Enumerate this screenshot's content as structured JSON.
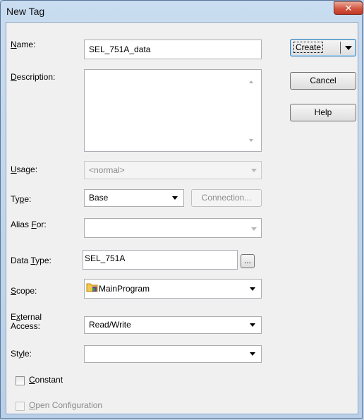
{
  "window": {
    "title": "New Tag",
    "close_glyph": "✕"
  },
  "fields": {
    "name": {
      "label_u": "N",
      "label_rest": "ame:",
      "value": "SEL_751A_data"
    },
    "description": {
      "label_u": "D",
      "label_rest": "escription:",
      "value": ""
    },
    "usage": {
      "label_u": "U",
      "label_rest": "sage:",
      "value": "<normal>"
    },
    "type": {
      "label_pre": "Ty",
      "label_u": "p",
      "label_rest": "e:",
      "value": "Base"
    },
    "connection_button": {
      "u": "C",
      "rest": "onnection..."
    },
    "alias_for": {
      "label_pre": "Alias ",
      "label_u": "F",
      "label_rest": "or:",
      "value": ""
    },
    "data_type": {
      "label_pre": "Data ",
      "label_u": "T",
      "label_rest": "ype:",
      "value": "SEL_751A",
      "browse": "..."
    },
    "scope": {
      "label_u": "S",
      "label_rest": "cope:",
      "value": "MainProgram",
      "icon": "program-folder-icon"
    },
    "external_access": {
      "line1_pre": "E",
      "line1_u": "x",
      "line1_rest": "ternal",
      "line2": "Access:",
      "value": "Read/Write"
    },
    "style": {
      "label_pre": "St",
      "label_u": "y",
      "label_rest": "le:",
      "value": ""
    }
  },
  "checkboxes": {
    "constant": {
      "u": "C",
      "rest": "onstant",
      "checked": false
    },
    "open_configuration": {
      "u": "O",
      "rest": "pen Configuration",
      "checked": false
    }
  },
  "buttons": {
    "create": "Create",
    "cancel": "Cancel",
    "help": "Help"
  },
  "colors": {
    "title_gradient": "#c9dcf0",
    "close_red": "#c23a25",
    "default_button_border": "#3c7fb1"
  }
}
